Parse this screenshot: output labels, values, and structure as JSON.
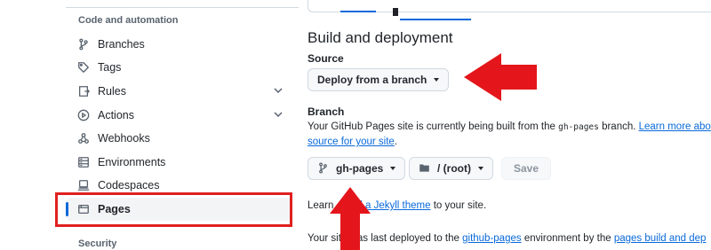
{
  "sidebar": {
    "heading_code": "Code and automation",
    "heading_security": "Security",
    "items": [
      {
        "label": "Branches",
        "icon": "branch-icon"
      },
      {
        "label": "Tags",
        "icon": "tag-icon"
      },
      {
        "label": "Rules",
        "icon": "rules-icon"
      },
      {
        "label": "Actions",
        "icon": "play-icon"
      },
      {
        "label": "Webhooks",
        "icon": "webhook-icon"
      },
      {
        "label": "Environments",
        "icon": "server-icon"
      },
      {
        "label": "Codespaces",
        "icon": "codespaces-icon"
      },
      {
        "label": "Pages",
        "icon": "browser-icon"
      }
    ],
    "active_item": "Pages"
  },
  "main": {
    "section_title": "Build and deployment",
    "source_label": "Source",
    "source_select": "Deploy from a branch",
    "branch_label": "Branch",
    "branch_desc_pre": "Your GitHub Pages site is currently being built from the ",
    "branch_desc_code": "gh-pages",
    "branch_desc_mid": " branch. ",
    "branch_desc_link": "Learn more abo",
    "branch_desc_link2": "source for your site",
    "branch_desc_end": ".",
    "branch_select": "gh-pages",
    "folder_select": "/ (root)",
    "save_label": "Save",
    "jekyll_pre": "Learn ",
    "jekyll_link": "add a Jekyll theme",
    "jekyll_post": " to your site.",
    "deployed_pre": "Your site ",
    "deployed_mid1": "was last deployed to the ",
    "deployed_link1": "github-pages",
    "deployed_mid2": " environment by the ",
    "deployed_link2": "pages build and dep"
  },
  "colors": {
    "accent": "#0969da",
    "annotation_red": "#e02020",
    "active_bar": "#0969da"
  }
}
